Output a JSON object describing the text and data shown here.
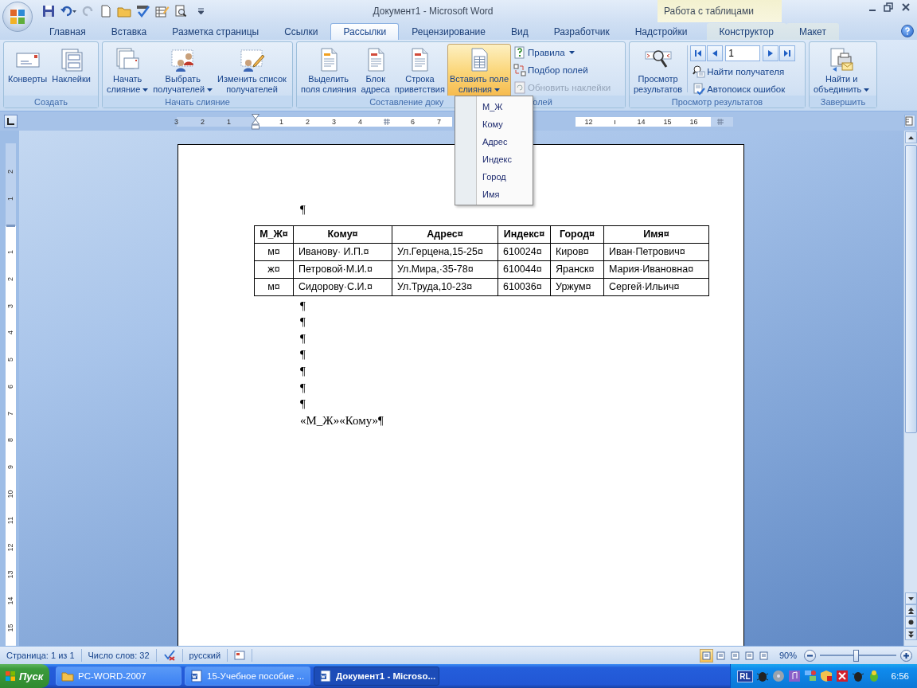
{
  "title_bar": {
    "title": "Документ1 - Microsoft Word",
    "context_header": "Работа с таблицами"
  },
  "ribbon_tabs": [
    {
      "label": "Главная",
      "selected": false,
      "kind": "normal"
    },
    {
      "label": "Вставка",
      "selected": false,
      "kind": "normal"
    },
    {
      "label": "Разметка страницы",
      "selected": false,
      "kind": "normal"
    },
    {
      "label": "Ссылки",
      "selected": false,
      "kind": "normal"
    },
    {
      "label": "Рассылки",
      "selected": true,
      "kind": "normal"
    },
    {
      "label": "Рецензирование",
      "selected": false,
      "kind": "normal"
    },
    {
      "label": "Вид",
      "selected": false,
      "kind": "normal"
    },
    {
      "label": "Разработчик",
      "selected": false,
      "kind": "normal"
    },
    {
      "label": "Надстройки",
      "selected": false,
      "kind": "normal"
    },
    {
      "label": "Конструктор",
      "selected": false,
      "kind": "contextual"
    },
    {
      "label": "Макет",
      "selected": false,
      "kind": "contextual"
    }
  ],
  "ribbon_groups": [
    {
      "label_parts": [
        "Создать"
      ],
      "buttons": [
        {
          "kind": "large",
          "lines": [
            "Конверты"
          ],
          "dropdown": false,
          "pressed": false,
          "disabled": false
        },
        {
          "kind": "large",
          "lines": [
            "Наклейки"
          ],
          "dropdown": false,
          "pressed": false,
          "disabled": false
        }
      ]
    },
    {
      "label_parts": [
        "Начать слияние"
      ],
      "buttons": [
        {
          "kind": "large",
          "lines": [
            "Начать",
            "слияние"
          ],
          "dropdown": true,
          "pressed": false,
          "disabled": false
        },
        {
          "kind": "large",
          "lines": [
            "Выбрать",
            "получателей"
          ],
          "dropdown": true,
          "pressed": false,
          "disabled": false
        },
        {
          "kind": "large",
          "lines": [
            "Изменить список",
            "получателей"
          ],
          "dropdown": false,
          "pressed": false,
          "disabled": false
        }
      ]
    },
    {
      "label_parts": [
        "Составление доку",
        "олей"
      ],
      "buttons": [
        {
          "kind": "large",
          "lines": [
            "Выделить",
            "поля слияния"
          ],
          "dropdown": false,
          "pressed": false,
          "disabled": false
        },
        {
          "kind": "large",
          "lines": [
            "Блок",
            "адреса"
          ],
          "dropdown": false,
          "pressed": false,
          "disabled": false
        },
        {
          "kind": "large",
          "lines": [
            "Строка",
            "приветствия"
          ],
          "dropdown": false,
          "pressed": false,
          "disabled": false
        },
        {
          "kind": "large",
          "lines": [
            "Вставить поле",
            "слияния"
          ],
          "dropdown": true,
          "pressed": true,
          "disabled": false
        },
        {
          "kind": "small",
          "lines": [
            "Правила"
          ],
          "dropdown": true,
          "pressed": false,
          "disabled": false
        },
        {
          "kind": "small",
          "lines": [
            "Подбор полей"
          ],
          "dropdown": false,
          "pressed": false,
          "disabled": false
        },
        {
          "kind": "small",
          "lines": [
            "Обновить наклейки"
          ],
          "dropdown": false,
          "pressed": false,
          "disabled": true
        }
      ]
    },
    {
      "label_parts": [
        "Просмотр результатов"
      ],
      "buttons": [
        {
          "kind": "large",
          "lines": [
            "Просмотр",
            "результатов"
          ],
          "dropdown": false,
          "pressed": false,
          "disabled": false
        },
        {
          "kind": "record-nav",
          "value": "1"
        },
        {
          "kind": "small",
          "lines": [
            "Найти получателя"
          ],
          "dropdown": false,
          "pressed": false,
          "disabled": false
        },
        {
          "kind": "small",
          "lines": [
            "Автопоиск ошибок"
          ],
          "dropdown": false,
          "pressed": false,
          "disabled": false
        }
      ]
    },
    {
      "label_parts": [
        "Завершить"
      ],
      "buttons": [
        {
          "kind": "large",
          "lines": [
            "Найти и",
            "объединить"
          ],
          "dropdown": true,
          "pressed": false,
          "disabled": false
        }
      ]
    }
  ],
  "merge_field_menu": {
    "items": [
      "М_Ж",
      "Кому",
      "Адрес",
      "Индекс",
      "Город",
      "Имя"
    ]
  },
  "horizontal_ruler": {
    "before_menu": [
      {
        "kind": "number",
        "label": "3"
      },
      {
        "kind": "number",
        "label": "2"
      },
      {
        "kind": "number",
        "label": "1"
      },
      {
        "kind": "indent"
      },
      {
        "kind": "number",
        "label": "1"
      },
      {
        "kind": "number",
        "label": "2"
      },
      {
        "kind": "number",
        "label": "3"
      },
      {
        "kind": "number",
        "label": "4"
      },
      {
        "kind": "tab-stop"
      },
      {
        "kind": "number",
        "label": "6"
      },
      {
        "kind": "number",
        "label": "7"
      }
    ],
    "after_menu": [
      {
        "kind": "number",
        "label": "12"
      },
      {
        "kind": "tick"
      },
      {
        "kind": "number",
        "label": "14"
      },
      {
        "kind": "number",
        "label": "15"
      },
      {
        "kind": "number",
        "label": "16"
      },
      {
        "kind": "tab-stop"
      }
    ]
  },
  "vertical_ruler": [
    {
      "kind": "number",
      "label": "2"
    },
    {
      "kind": "number",
      "label": "1"
    },
    {
      "kind": "margin"
    },
    {
      "kind": "number",
      "label": "1"
    },
    {
      "kind": "number",
      "label": "2"
    },
    {
      "kind": "number",
      "label": "3"
    },
    {
      "kind": "number",
      "label": "4"
    },
    {
      "kind": "number",
      "label": "5"
    },
    {
      "kind": "number",
      "label": "6"
    },
    {
      "kind": "number",
      "label": "7"
    },
    {
      "kind": "number",
      "label": "8"
    },
    {
      "kind": "number",
      "label": "9"
    },
    {
      "kind": "number",
      "label": "10"
    },
    {
      "kind": "number",
      "label": "11"
    },
    {
      "kind": "number",
      "label": "12"
    },
    {
      "kind": "number",
      "label": "13"
    },
    {
      "kind": "number",
      "label": "14"
    },
    {
      "kind": "number",
      "label": "15"
    }
  ],
  "document": {
    "leading_paragraph": "¶",
    "table": {
      "columns": [
        "М_Ж¤",
        "Кому¤",
        "Адрес¤",
        "Индекс¤",
        "Город¤",
        "Имя¤"
      ],
      "rows": [
        [
          "м¤",
          "Иванову· И.П.¤",
          "Ул.Герцена,15-25¤",
          "610024¤",
          "Киров¤",
          "Иван·Петрович¤"
        ],
        [
          "ж¤",
          "Петровой·М.И.¤",
          "Ул.Мира,·35-78¤",
          "610044¤",
          "Яранск¤",
          "Мария·Ивановна¤"
        ],
        [
          "м¤",
          "Сидорову·С.И.¤",
          "Ул.Труда,10-23¤",
          "610036¤",
          "Уржум¤",
          "Сергей·Ильич¤"
        ]
      ]
    },
    "empty_paragraphs": [
      "¶",
      "¶",
      "¶",
      "¶",
      "¶",
      "¶",
      "¶"
    ],
    "merge_line": "«М_Ж»«Кому»¶"
  },
  "status_bar": {
    "items": [
      "Страница: 1 из 1",
      "Число слов: 32"
    ],
    "language": "русский",
    "views": [
      {
        "selected": true
      },
      {
        "selected": false
      },
      {
        "selected": false
      },
      {
        "selected": false
      },
      {
        "selected": false
      }
    ],
    "zoom": "90%",
    "zoom_slider": {
      "level": 0.47
    }
  },
  "taskbar": {
    "start": "Пуск",
    "windows": [
      {
        "label": "PC-WORD-2007",
        "selected": false
      },
      {
        "label": "15-Учебное пособие ...",
        "selected": false
      },
      {
        "label": "Документ1 - Microso...",
        "selected": true
      }
    ],
    "tray_badge": "RL",
    "clock": "6:56"
  }
}
